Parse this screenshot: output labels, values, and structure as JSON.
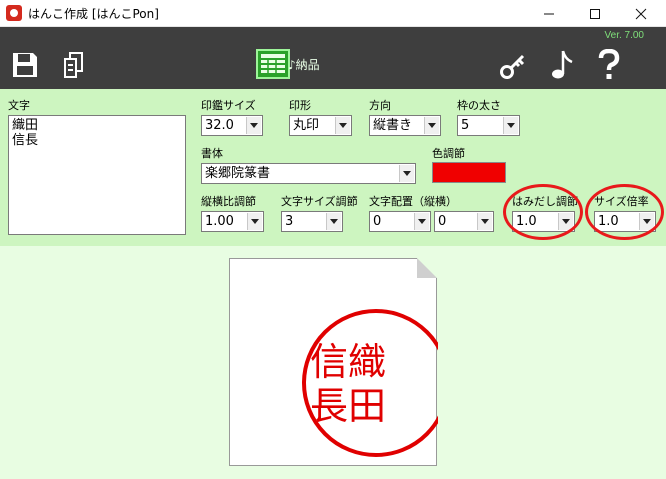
{
  "window": {
    "title": "はんこ作成 [はんこPon]"
  },
  "toolbar": {
    "version": "Ver. 7.00",
    "deliver_label": "納品",
    "icons": [
      "save-icon",
      "copy-icon",
      "deliver-icon",
      "key-icon",
      "music-note-icon",
      "help-icon"
    ]
  },
  "panel": {
    "text_label": "文字",
    "text_lines": [
      "織田",
      "信長"
    ],
    "size": {
      "label": "印鑑サイズ",
      "value": "32.0"
    },
    "shape": {
      "label": "印形",
      "value": "丸印"
    },
    "direction": {
      "label": "方向",
      "value": "縦書き"
    },
    "frame_width": {
      "label": "枠の太さ",
      "value": "5"
    },
    "font": {
      "label": "書体",
      "value": "楽郷院篆書"
    },
    "color": {
      "label": "色調節",
      "value": "#f00000"
    },
    "aspect": {
      "label": "縦横比調節",
      "value": "1.00"
    },
    "char_size": {
      "label": "文字サイズ調節",
      "value": "3"
    },
    "layout": {
      "label": "文字配置（縦横）",
      "value_v": "0",
      "value_h": "0"
    },
    "overflow": {
      "label": "はみだし調節",
      "value": "1.0"
    },
    "scale": {
      "label": "サイズ倍率",
      "value": "1.0"
    }
  },
  "preview": {
    "stamp_chars": [
      "織",
      "田",
      "信",
      "長"
    ],
    "stamp_color": "#e00000"
  }
}
